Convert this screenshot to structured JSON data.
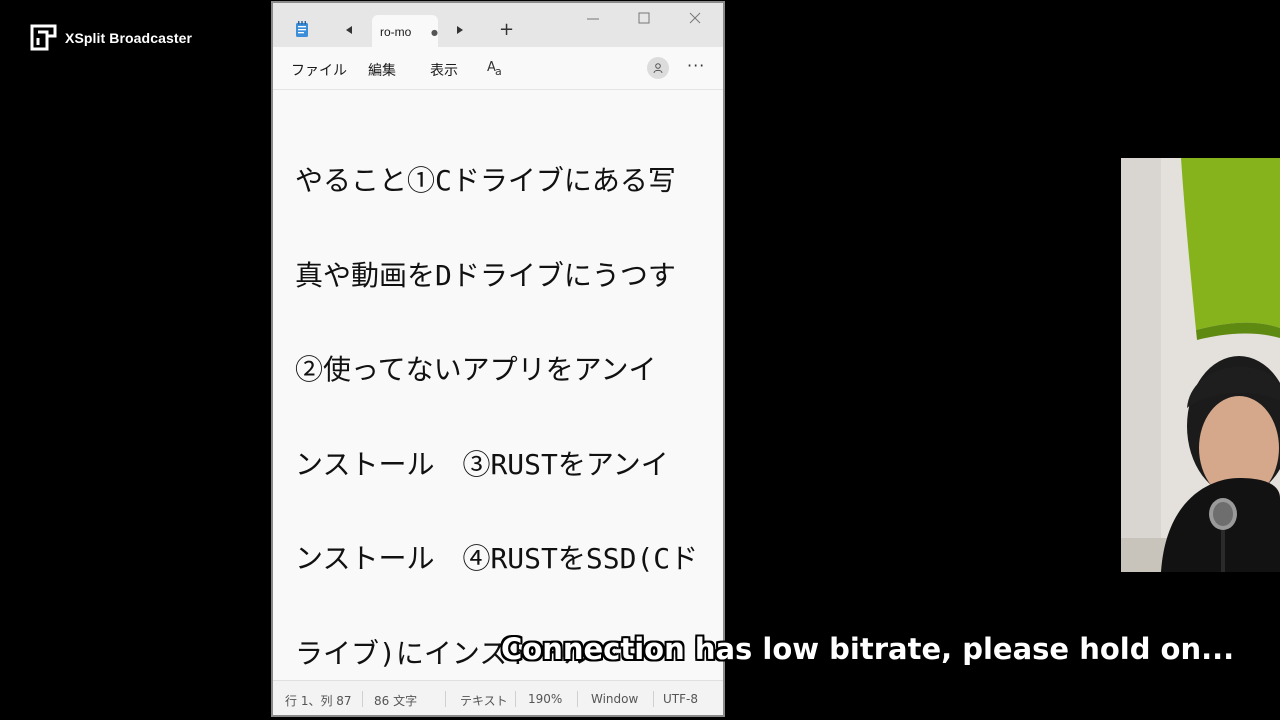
{
  "overlay": {
    "brand": "XSplit Broadcaster",
    "notice": "Connection has low bitrate, please hold on..."
  },
  "notepad": {
    "tab_title": "ro-mo",
    "menu": {
      "file": "ファイル",
      "edit": "編集",
      "view": "表示"
    },
    "content_lines": [
      "やること①Cドライブにある写",
      "真や動画をDドライブにうつす",
      "②使ってないアプリをアンイ",
      "ンストール　③RUSTをアンイ",
      "ンストール　④RUSTをSSD(Cド",
      "ライブ)にインストール"
    ],
    "status": {
      "position": "行 1、列 87",
      "char_count": "86 文字",
      "format": "テキスト",
      "zoom": "190%",
      "line_ending": "Window",
      "encoding": "UTF-8"
    }
  },
  "icons": {
    "app": "notepad-icon",
    "font": "font-icon",
    "account": "account-icon"
  },
  "colors": {
    "background": "#000000",
    "window": "#f9f9f9",
    "titlebar": "#e6e6e6",
    "text": "#111111",
    "notice_text": "#ffffff"
  }
}
